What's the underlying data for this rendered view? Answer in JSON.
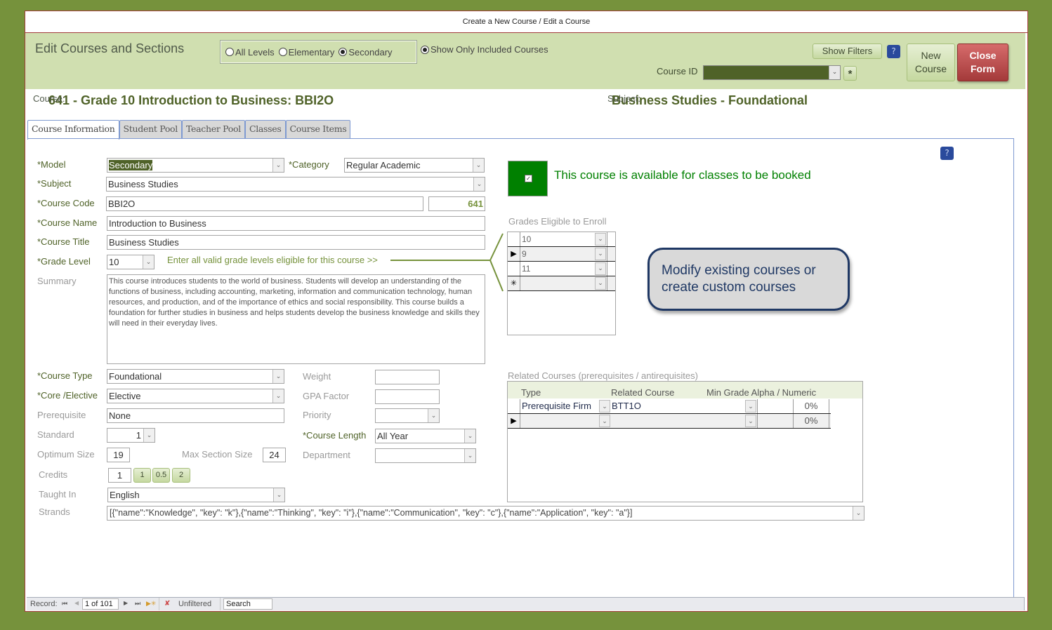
{
  "window": {
    "title": "Create a New Course / Edit a Course"
  },
  "header": {
    "form_title": "Edit Courses and Sections",
    "level_options": [
      {
        "label": "All Levels",
        "selected": false
      },
      {
        "label": "Elementary",
        "selected": false
      },
      {
        "label": "Secondary",
        "selected": true
      }
    ],
    "show_only_included": {
      "label": "Show Only Included Courses",
      "selected": true
    },
    "show_filters_label": "Show Filters",
    "help_label": "?",
    "course_id_label": "Course ID",
    "course_id_value": "",
    "new_record_label": "*",
    "new_course_label_line1": "New",
    "new_course_label_line2": "Course",
    "close_form_label_line1": "Close",
    "close_form_label_line2": "Form"
  },
  "summary": {
    "course_label": "Course:",
    "course_value": "641  - Grade 10 Introduction to Business: BBI2O",
    "subject_label": "Subject:",
    "subject_value": "Business Studies - Foundational"
  },
  "tabs": [
    {
      "label": "Course Information",
      "active": true
    },
    {
      "label": "Student Pool",
      "active": false
    },
    {
      "label": "Teacher Pool",
      "active": false
    },
    {
      "label": "Classes",
      "active": false
    },
    {
      "label": "Course Items",
      "active": false
    }
  ],
  "form": {
    "help_label": "?",
    "model": {
      "label": "*Model",
      "value": "Secondary"
    },
    "category": {
      "label": "*Category",
      "value": "Regular Academic"
    },
    "subject": {
      "label": "*Subject",
      "value": "Business Studies"
    },
    "course_code": {
      "label": "*Course Code",
      "value": "BBI2O",
      "id": "641"
    },
    "course_name": {
      "label": "*Course Name",
      "value": "Introduction to Business"
    },
    "course_title": {
      "label": "*Course Title",
      "value": "Business Studies"
    },
    "grade_level": {
      "label": "*Grade Level",
      "value": "10"
    },
    "grade_hint": "Enter all valid grade levels eligible for this course >>",
    "summary": {
      "label": "Summary",
      "value": "This course introduces students to the world of business. Students will develop an understanding of the functions of business, including accounting, marketing, information and communication technology, human resources, and production, and of the importance of ethics and social responsibility. This course builds a foundation for further studies in business and helps students develop the business knowledge and skills they will need in their everyday lives."
    },
    "course_type": {
      "label": "*Course Type",
      "value": "Foundational"
    },
    "core_elective": {
      "label": "*Core /Elective",
      "value": "Elective"
    },
    "prerequisite": {
      "label": "Prerequisite",
      "value": "None"
    },
    "standard": {
      "label": "Standard",
      "value": "1"
    },
    "optimum_size": {
      "label": "Optimum Size",
      "value": "19"
    },
    "max_section_size": {
      "label": "Max Section Size",
      "value": "24"
    },
    "credits": {
      "label": "Credits",
      "value": "1",
      "quick_buttons": [
        "1",
        "0.5",
        "2"
      ]
    },
    "taught_in": {
      "label": "Taught In",
      "value": "English"
    },
    "strands": {
      "label": "Strands",
      "value": "[{\"name\":\"Knowledge\", \"key\": \"k\"},{\"name\":\"Thinking\", \"key\": \"i\"},{\"name\":\"Communication\", \"key\": \"c\"},{\"name\":\"Application\", \"key\": \"a\"}]"
    },
    "weight": {
      "label": "Weight",
      "value": ""
    },
    "gpa_factor": {
      "label": "GPA Factor",
      "value": ""
    },
    "priority": {
      "label": "Priority",
      "value": ""
    },
    "course_length": {
      "label": "*Course Length",
      "value": "All Year"
    },
    "department": {
      "label": "Department",
      "value": ""
    }
  },
  "availability": {
    "checked": true,
    "text": "This course is available for classes to be booked"
  },
  "grades_eligible": {
    "label": "Grades Eligible to Enroll",
    "rows": [
      {
        "selector": "",
        "value": "10"
      },
      {
        "selector": "▶",
        "value": "9"
      },
      {
        "selector": "",
        "value": "11"
      },
      {
        "selector": "✳",
        "value": ""
      }
    ]
  },
  "callout": {
    "text": "Modify existing courses or create custom courses"
  },
  "related_courses": {
    "label": "Related Courses (prerequisites / antirequisites)",
    "headers": {
      "type": "Type",
      "related": "Related Course",
      "min_grade": "Min Grade Alpha  / Numeric"
    },
    "rows": [
      {
        "selector": "",
        "type": "Prerequisite Firm",
        "related": "BTT1O",
        "alpha": "",
        "numeric": "0%"
      },
      {
        "selector": "▶",
        "type": "",
        "related": "",
        "alpha": "",
        "numeric": "0%"
      }
    ]
  },
  "record_nav": {
    "label": "Record:",
    "position": "1 of 101",
    "filter_status": "Unfiltered",
    "search_placeholder": "Search"
  }
}
